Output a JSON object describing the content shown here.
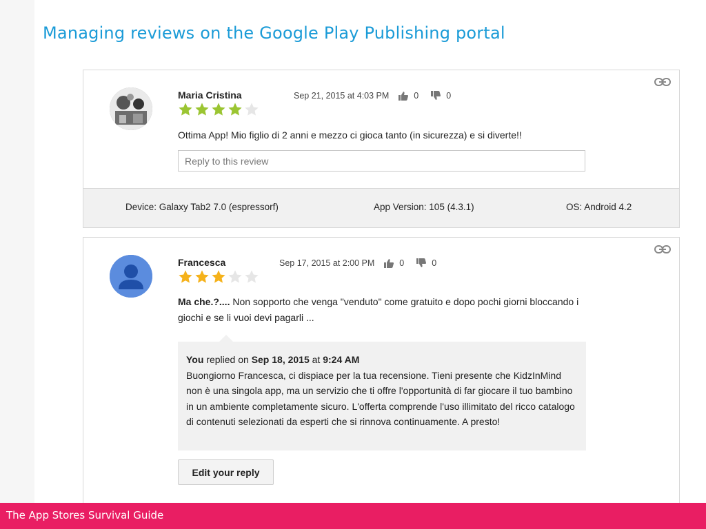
{
  "slide": {
    "title": "Managing reviews on the Google Play Publishing portal",
    "footer": "The App Stores Survival Guide"
  },
  "reviews": [
    {
      "reviewer": "Maria Cristina",
      "date": "Sep 21, 2015 at 4:03 PM",
      "thumbs_up": "0",
      "thumbs_down": "0",
      "rating": 4,
      "max_rating": 5,
      "text": "Ottima App! Mio figlio di 2 anni e mezzo ci gioca tanto (in sicurezza) e si diverte!!",
      "reply_placeholder": "Reply to this review",
      "device": "Device: Galaxy Tab2 7.0 (espressorf)",
      "app_version": "App Version: 105 (4.3.1)",
      "os": "OS: Android 4.2",
      "star_color": "#9bc532"
    },
    {
      "reviewer": "Francesca",
      "date": "Sep 17, 2015 at 2:00 PM",
      "thumbs_up": "0",
      "thumbs_down": "0",
      "rating": 3,
      "max_rating": 5,
      "text_title": "Ma che.?....",
      "text": " Non sopporto  che venga \"venduto\" come gratuito e dopo pochi giorni bloccando i giochi e se li vuoi devi pagarli ...",
      "reply": {
        "author": "You",
        "replied_on": " replied on ",
        "date": "Sep 18, 2015",
        "at": " at ",
        "time": "9:24 AM",
        "text": "Buongiorno Francesca, ci dispiace per la tua recensione. Tieni presente che KidzInMind non è una singola app, ma un servizio che ti offre l'opportunità di far giocare il tuo bambino in un ambiente completamente sicuro. L'offerta comprende l'uso illimitato del ricco catalogo di contenuti selezionati da esperti che si rinnova continuamente. A presto!"
      },
      "edit_reply_label": "Edit your reply",
      "star_color": "#f5b21b"
    }
  ],
  "colors": {
    "title": "#1a9bd7",
    "footer_bg": "#e91e63",
    "empty_star": "#e6e6e6"
  }
}
